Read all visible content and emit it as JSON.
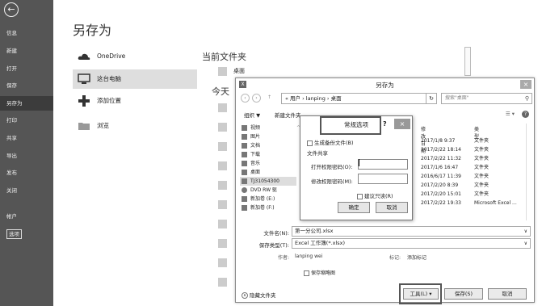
{
  "nav": {
    "back": "←",
    "items": [
      "信息",
      "新建",
      "打开",
      "保存",
      "另存为",
      "打印",
      "共享",
      "导出",
      "发布",
      "关闭",
      "帐户",
      "选项"
    ]
  },
  "panel": {
    "title": "另存为",
    "locations": [
      "OneDrive",
      "这台电脑",
      "添加位置",
      "浏览"
    ],
    "current_folder_title": "当前文件夹",
    "desktop_label": "桌面",
    "today_title": "今天"
  },
  "dialog": {
    "title": "另存为",
    "icon": "X",
    "close": "×",
    "breadcrumb": "« 用户 › lanping › 桌面",
    "search_placeholder": "搜索\"桌面\"",
    "organize": "组织 ▼",
    "new_folder": "新建文件夹",
    "tree": [
      "视频",
      "图片",
      "文档",
      "下载",
      "音乐",
      "桌面",
      "TJ31054300",
      "DVD RW 驱",
      "新加卷 (E:)",
      "新加卷 (F:)"
    ],
    "columns": {
      "date": "修改日期",
      "type": "类型"
    },
    "files": [
      {
        "date": "2017/1/8 9:37",
        "type": "文件夹"
      },
      {
        "date": "2017/2/22 18:14",
        "type": "文件夹"
      },
      {
        "date": "2017/2/22 11:32",
        "type": "文件夹"
      },
      {
        "date": "2017/1/6 16:47",
        "type": "文件夹"
      },
      {
        "date": "2016/6/17 11:39",
        "type": "文件夹"
      },
      {
        "date": "2017/2/20 8:39",
        "type": "文件夹"
      },
      {
        "date": "2017/2/20 15:01",
        "type": "文件夹"
      },
      {
        "date": "2017/2/22 19:33",
        "type": "Microsoft Excel ..."
      }
    ],
    "filename_label": "文件名(N):",
    "filename_value": "第一分公司.xlsx",
    "filetype_label": "保存类型(T):",
    "filetype_value": "Excel 工作簿(*.xlsx)",
    "author_label": "作者:",
    "author_value": "lanping wei",
    "tags_label": "标记:",
    "tags_value": "添加标记",
    "thumbnail_label": "保存缩略图",
    "hide_folders": "隐藏文件夹",
    "tools_button": "工具(L)",
    "save_button": "保存(S)",
    "cancel_button": "取消"
  },
  "options": {
    "title": "常规选项",
    "help": "?",
    "close": "×",
    "backup_label": "生成备份文件(B)",
    "sharing_label": "文件共享",
    "open_pw_label": "打开权限密码(O):",
    "modify_pw_label": "修改权限密码(M):",
    "readonly_label": "建议只读(R)",
    "ok": "确定",
    "cancel": "取消"
  }
}
